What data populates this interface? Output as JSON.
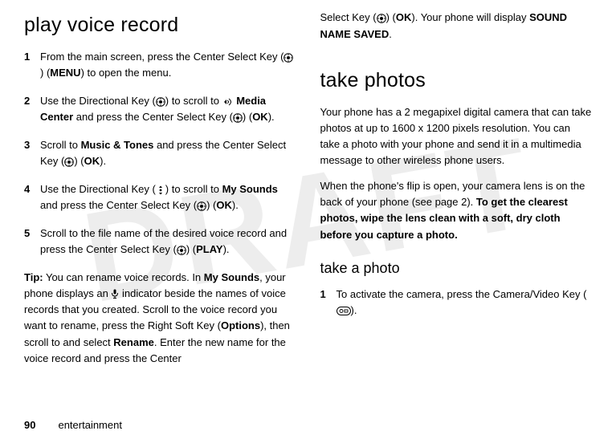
{
  "watermark": "DRAFT",
  "left": {
    "title": "play voice record",
    "steps": [
      {
        "num": "1",
        "body_pre": "From the main screen, press the Center Select Key (",
        "icon": "dpad-center",
        "body_mid": ") (",
        "bold1": "MENU",
        "body_post": ") to open the menu."
      },
      {
        "num": "2",
        "body_pre": "Use the Directional Key (",
        "icon": "dpad-center",
        "body_mid": ") to scroll to ",
        "icon2": "media",
        "bold1": " Media Center",
        "body_mid2": " and press the Center Select Key (",
        "icon3": "dpad-center",
        "body_mid3": ") (",
        "bold2": "OK",
        "body_post": ")."
      },
      {
        "num": "3",
        "body_pre": "Scroll to ",
        "bold1": "Music & Tones",
        "body_mid": " and press the Center Select Key (",
        "icon": "dpad-center",
        "body_mid2": ") (",
        "bold2": "OK",
        "body_post": ")."
      },
      {
        "num": "4",
        "body_pre": "Use the Directional Key (",
        "icon": "dpad-updown",
        "body_mid": ") to scroll to ",
        "bold1": "My Sounds",
        "body_mid2": " and press the Center Select Key (",
        "icon2": "dpad-center",
        "body_mid3": ") (",
        "bold2": "OK",
        "body_post": ")."
      },
      {
        "num": "5",
        "body_pre": "Scroll to the file name of the desired voice record and press the Center Select Key (",
        "icon": "dpad-center",
        "body_mid": ") (",
        "bold1": "PLAY",
        "body_post": ")."
      }
    ],
    "tip_label": "Tip:",
    "tip_1": " You can rename voice records. In ",
    "tip_bold1": "My Sounds",
    "tip_2": ", your phone displays an ",
    "tip_icon": "mic",
    "tip_3": " indicator beside the names of voice records that you created. Scroll to the voice record you want to rename, press the Right Soft Key (",
    "tip_bold2": "Options",
    "tip_4": "), then scroll to and select ",
    "tip_bold3": "Rename",
    "tip_5": ". Enter the new name for the voice record and press the Center"
  },
  "right": {
    "cont_pre": "Select Key (",
    "cont_icon": "dpad-center",
    "cont_mid": ") (",
    "cont_bold1": "OK",
    "cont_mid2": "). Your phone will display ",
    "cont_bold2": "SOUND NAME SAVED",
    "cont_post": ".",
    "title": "take photos",
    "para1": "Your phone has a 2 megapixel digital camera that can take photos at up to 1600 x 1200 pixels resolution. You can take a photo with your phone and send it in a multimedia message to other wireless phone users.",
    "para2_pre": "When the phone's flip is open, your camera lens is on the back of your phone (see page 2). ",
    "para2_bold": "To get the clearest photos, wipe the lens clean with a soft, dry cloth before you capture a photo.",
    "subsection": "take a photo",
    "step1_num": "1",
    "step1_pre": "To activate the camera, press the Camera/Video Key (",
    "step1_icon": "camera-key",
    "step1_post": ")."
  },
  "footer": {
    "page": "90",
    "section": "entertainment"
  }
}
